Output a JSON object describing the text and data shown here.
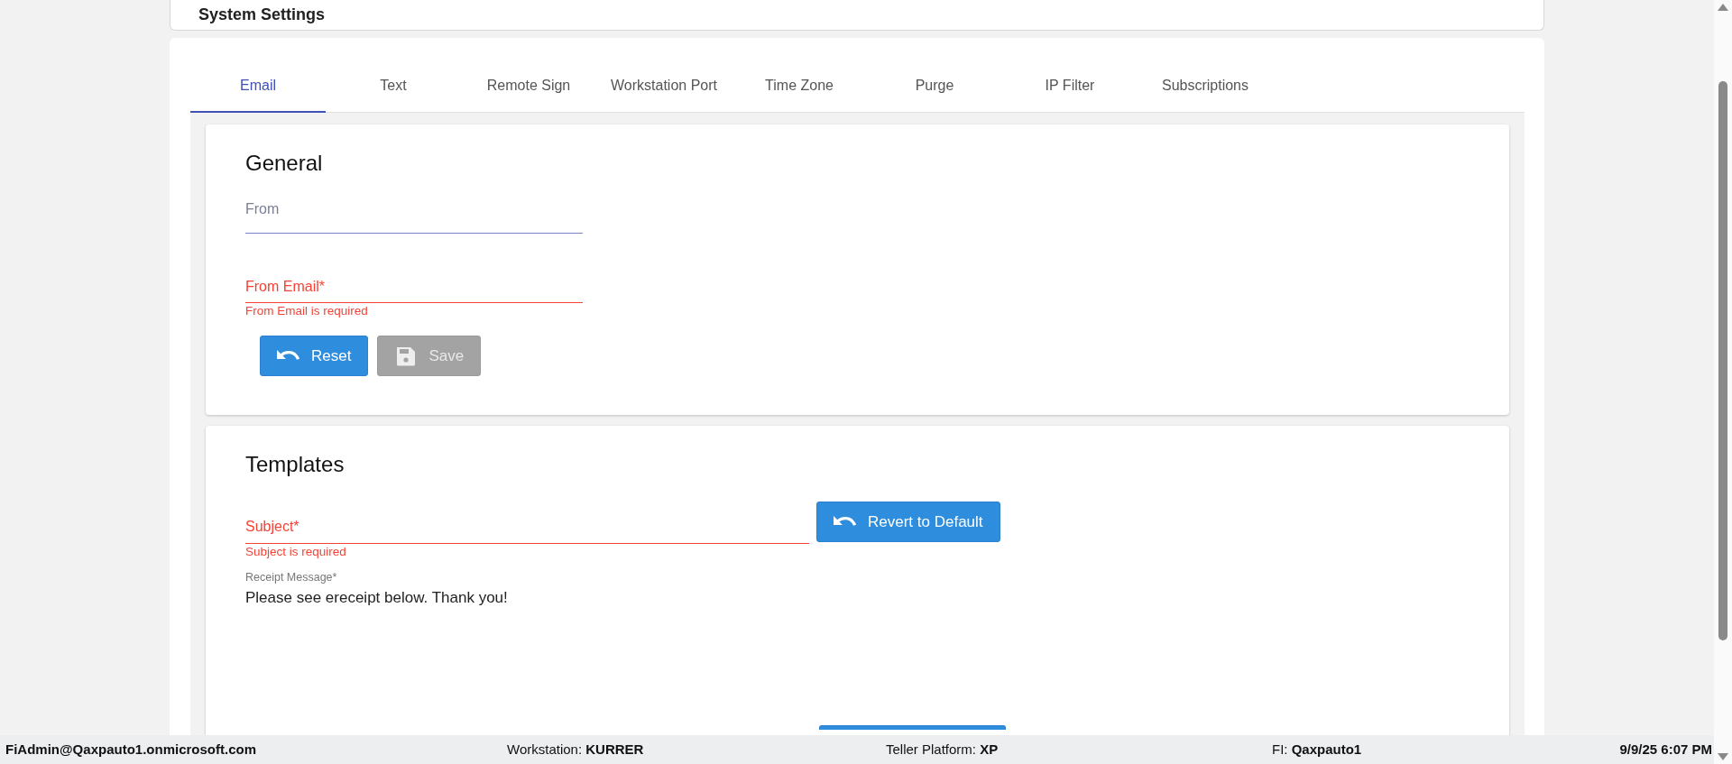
{
  "header": {
    "title": "System Settings"
  },
  "tabs": [
    {
      "label": "Email",
      "selected": true
    },
    {
      "label": "Text",
      "selected": false
    },
    {
      "label": "Remote Sign",
      "selected": false
    },
    {
      "label": "Workstation Port",
      "selected": false
    },
    {
      "label": "Time Zone",
      "selected": false
    },
    {
      "label": "Purge",
      "selected": false
    },
    {
      "label": "IP Filter",
      "selected": false
    },
    {
      "label": "Subscriptions",
      "selected": false
    }
  ],
  "general": {
    "title": "General",
    "fields": [
      {
        "label": "From",
        "invalid": false
      },
      {
        "label": "From Email*",
        "invalid": true,
        "error": "From Email is required"
      }
    ],
    "buttons": [
      {
        "label": "Reset",
        "kind": "reset",
        "disabled": false
      },
      {
        "label": "Save",
        "kind": "save",
        "disabled": true
      }
    ]
  },
  "templates": {
    "title": "Templates",
    "subject": {
      "label": "Subject*",
      "invalid": true,
      "error": "Subject is required"
    },
    "revert_button": {
      "label": "Revert to Default"
    },
    "message": {
      "label": "Receipt Message*",
      "value": "Please see ereceipt below. Thank you!"
    }
  },
  "status_bar": {
    "user": "FiAdmin@Qaxpauto1.onmicrosoft.com",
    "items": [
      {
        "text": "Workstation: **KURRER**"
      },
      {
        "text": "Teller Platform: **XP**"
      },
      {
        "text": "FI: **Qaxpauto1**"
      }
    ],
    "datetime": "9/9/25 6:07 PM"
  }
}
